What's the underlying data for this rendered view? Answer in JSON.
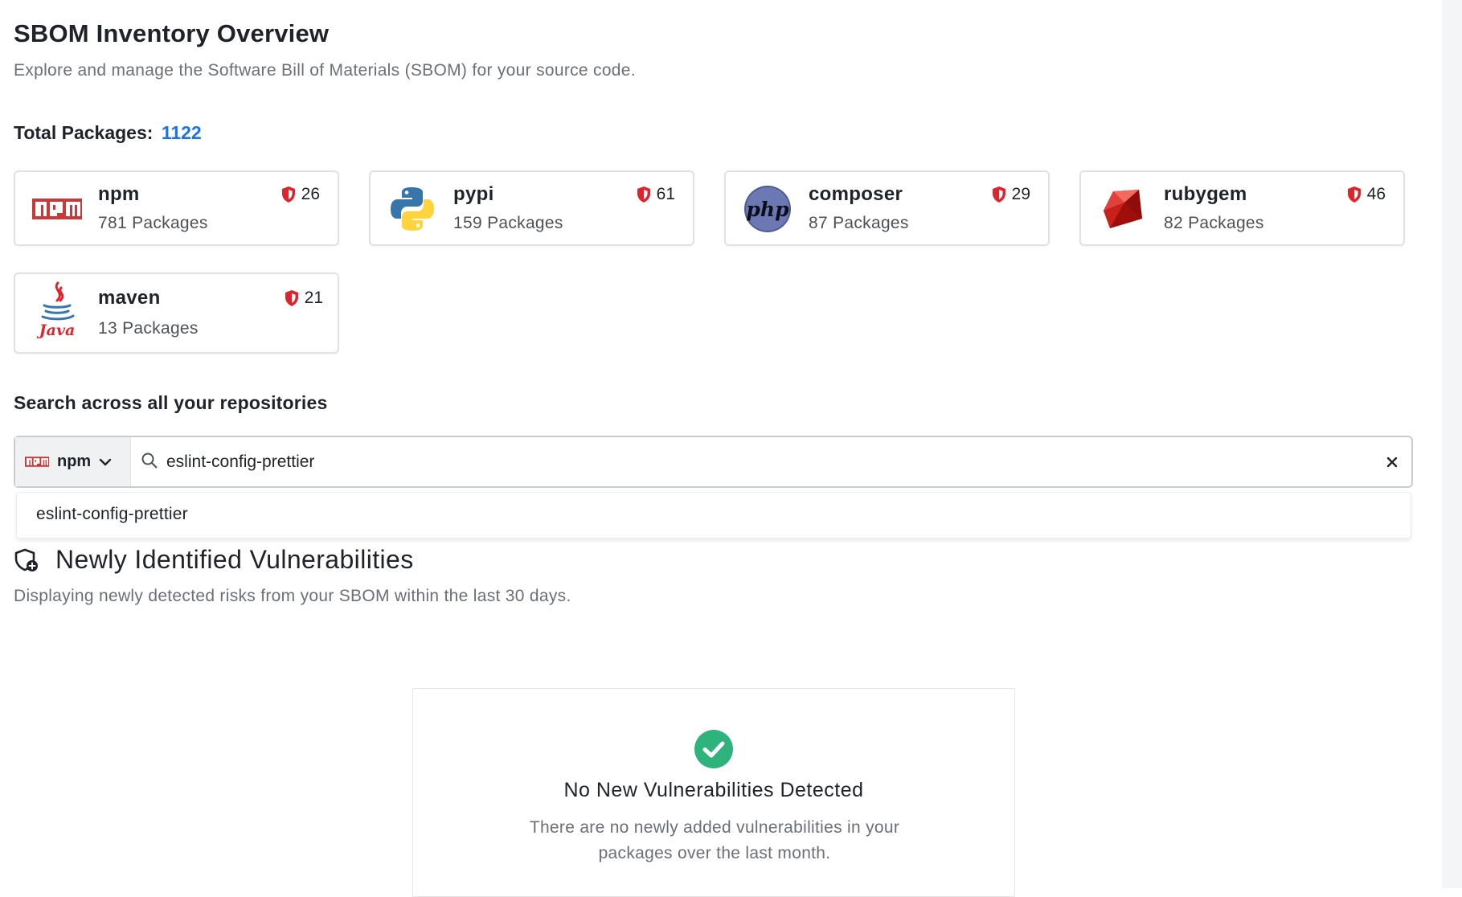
{
  "header": {
    "title": "SBOM Inventory Overview",
    "subtitle": "Explore and manage the Software Bill of Materials (SBOM) for your source code."
  },
  "total": {
    "label": "Total Packages:",
    "count": "1122"
  },
  "ecosystems": [
    {
      "name": "npm",
      "packages": "781 Packages",
      "vulns": "26",
      "icon": "npm-logo-icon"
    },
    {
      "name": "pypi",
      "packages": "159 Packages",
      "vulns": "61",
      "icon": "python-logo-icon"
    },
    {
      "name": "composer",
      "packages": "87 Packages",
      "vulns": "29",
      "icon": "php-logo-icon"
    },
    {
      "name": "rubygem",
      "packages": "82 Packages",
      "vulns": "46",
      "icon": "ruby-logo-icon"
    },
    {
      "name": "maven",
      "packages": "13 Packages",
      "vulns": "21",
      "icon": "java-logo-icon"
    }
  ],
  "search": {
    "heading": "Search across all your repositories",
    "ecosystem": "npm",
    "value": "eslint-config-prettier",
    "suggestions": [
      "eslint-config-prettier"
    ]
  },
  "vulnerabilities": {
    "title": "Newly Identified Vulnerabilities",
    "subtitle": "Displaying newly detected risks from your SBOM within the last 30 days.",
    "empty_title": "No New Vulnerabilities Detected",
    "empty_desc": "There are no newly added vulnerabilities in your packages over the last month."
  },
  "colors": {
    "accent": "#1a73e8",
    "shield": "#e0242b",
    "success": "#2fb37c",
    "npm": "#cb3837"
  }
}
